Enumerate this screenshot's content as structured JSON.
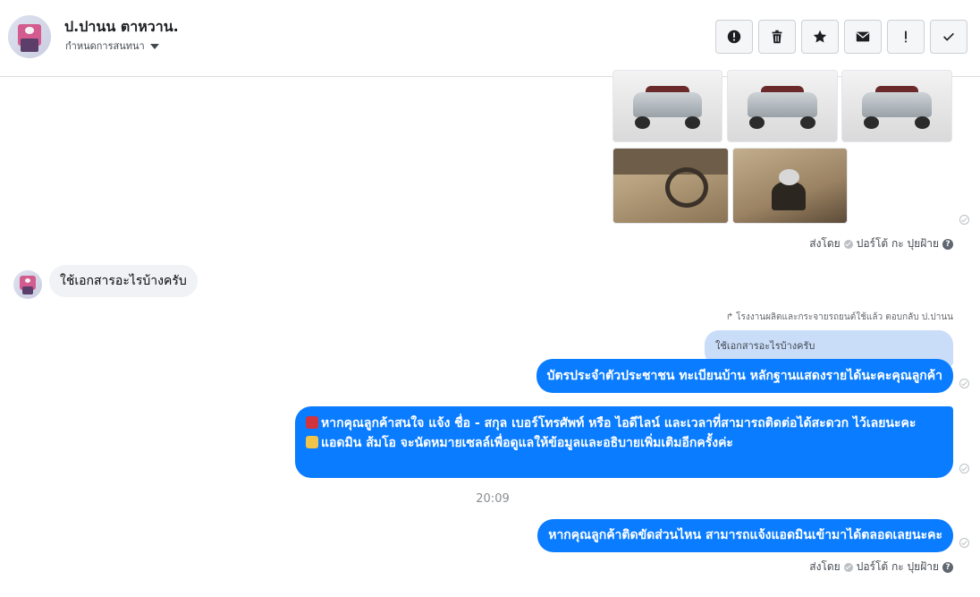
{
  "header": {
    "name": "ป.ปานน ตาหวาน.",
    "subtitle": "กำหนดการสนทนา",
    "actions": [
      {
        "name": "report-button",
        "icon": "alert-circle-icon"
      },
      {
        "name": "delete-button",
        "icon": "trash-icon"
      },
      {
        "name": "star-button",
        "icon": "star-icon"
      },
      {
        "name": "mail-button",
        "icon": "mail-icon"
      },
      {
        "name": "important-button",
        "icon": "exclamation-icon"
      },
      {
        "name": "done-button",
        "icon": "check-icon"
      }
    ]
  },
  "attachments": {
    "images": [
      "car-front-left",
      "car-front-right",
      "car-front",
      "car-interior-dashboard",
      "car-gear-shift"
    ]
  },
  "sent_by_1": {
    "label": "ส่งโดย",
    "agent": "ปอร์โต้ กะ ปุยฝ้าย"
  },
  "incoming": {
    "text": "ใช้เอกสารอะไรบ้างครับ"
  },
  "reply_note": "โรงงานผลิตและกระจายรถยนต์ใช้แล้ว ตอบกลับ ป.ปานน",
  "quoted_text": "ใช้เอกสารอะไรบ้างครับ",
  "outgoing": {
    "msg1": "บัตรประจำตัวประชาชน ทะเบียนบ้าน หลักฐานแสดงรายได้นะคะคุณลูกค้า",
    "msg2_line1": "หากคุณลูกค้าสนใจ แจ้ง ชื่อ - สกุล เบอร์โทรศัพท์ หรือ ไอดีไลน์ และเวลาที่สามารถติดต่อได้สะดวก ไว้เลยนะคะ",
    "msg2_line2": "แอดมิน ส้มโอ จะนัดหมายเซลล์เพื่อดูแลให้ข้อมูลและอธิบายเพิ่มเติมอีกครั้งค่ะ",
    "msg3": "หากคุณลูกค้าติดขัดส่วนไหน สามารถแจ้งแอดมินเข้ามาได้ตลอดเลยนะคะ"
  },
  "timestamp": "20:09",
  "sent_by_2": {
    "label": "ส่งโดย",
    "agent": "ปอร์โต้ กะ ปุยฝ้าย"
  },
  "colors": {
    "accent": "#0a7cff",
    "incoming_bubble": "#f0f2f5",
    "quoted_bubble": "#c9ddf9"
  }
}
